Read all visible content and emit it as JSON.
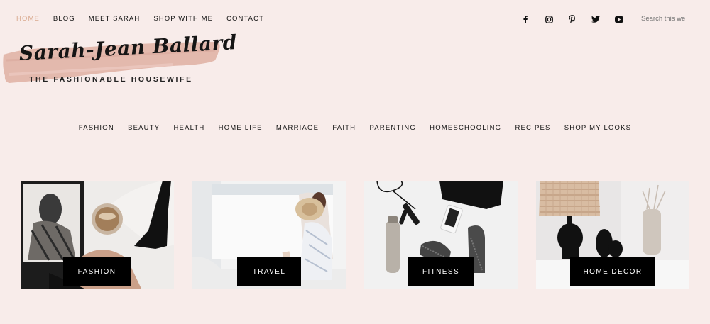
{
  "nav": {
    "items": [
      {
        "label": "HOME",
        "active": true
      },
      {
        "label": "BLOG"
      },
      {
        "label": "MEET SARAH"
      },
      {
        "label": "SHOP WITH ME"
      },
      {
        "label": "CONTACT"
      }
    ],
    "active_color": "#d9a98e"
  },
  "social": [
    "facebook-icon",
    "instagram-icon",
    "pinterest-icon",
    "twitter-icon",
    "youtube-icon"
  ],
  "search": {
    "placeholder": "Search this we"
  },
  "logo": {
    "name": "Sarah-Jean Ballard",
    "tagline": "THE FASHIONABLE HOUSEWIFE",
    "brush_color": "#e3b9ad"
  },
  "categories": [
    "FASHION",
    "BEAUTY",
    "HEALTH",
    "HOME LIFE",
    "MARRIAGE",
    "FAITH",
    "PARENTING",
    "HOMESCHOOLING",
    "RECIPES",
    "SHOP MY LOOKS"
  ],
  "cards": [
    {
      "label": "FASHION"
    },
    {
      "label": "TRAVEL"
    },
    {
      "label": "FITNESS"
    },
    {
      "label": "HOME DECOR"
    }
  ],
  "colors": {
    "background": "#f8ecea",
    "text": "#111111"
  }
}
